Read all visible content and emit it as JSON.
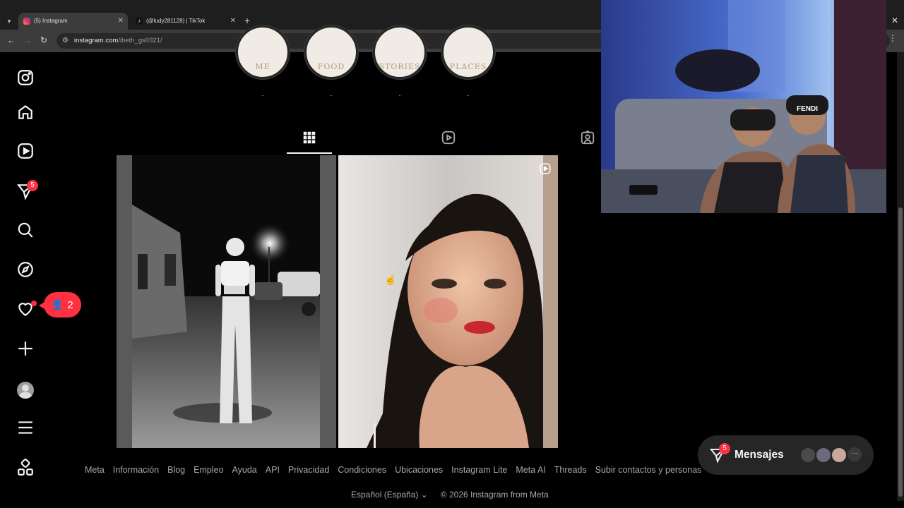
{
  "browser": {
    "tabs": [
      {
        "title": "(5) Instagram",
        "active": true
      },
      {
        "title": "(@ludy281128) | TikTok",
        "active": false
      }
    ],
    "new_tab_label": "+",
    "url_host": "instagram.com",
    "url_path": "/ibeth_gs0321/"
  },
  "sidebar": {
    "items": [
      {
        "icon": "instagram-logo-icon"
      },
      {
        "icon": "home-icon"
      },
      {
        "icon": "reels-icon"
      },
      {
        "icon": "messenger-icon",
        "badge": "5"
      },
      {
        "icon": "search-icon"
      },
      {
        "icon": "explore-icon"
      },
      {
        "icon": "heart-icon"
      },
      {
        "icon": "plus-icon"
      },
      {
        "icon": "profile-avatar"
      },
      {
        "icon": "menu-icon"
      },
      {
        "icon": "apps-icon"
      }
    ],
    "notification_count": "2"
  },
  "highlights": [
    {
      "art": "ME",
      "label": "."
    },
    {
      "art": "FOOD",
      "label": "."
    },
    {
      "art": "STORIES",
      "label": "."
    },
    {
      "art": "PLACES",
      "label": "."
    }
  ],
  "profile_tabs": [
    {
      "icon": "grid-icon",
      "active": true
    },
    {
      "icon": "reels-icon",
      "active": false
    },
    {
      "icon": "tagged-icon",
      "active": false
    }
  ],
  "footer": {
    "links": [
      "Meta",
      "Información",
      "Blog",
      "Empleo",
      "Ayuda",
      "API",
      "Privacidad",
      "Condiciones",
      "Ubicaciones",
      "Instagram Lite",
      "Meta AI",
      "Threads",
      "Subir contactos y personas"
    ],
    "language": "Español (España)",
    "copyright": "© 2026 Instagram from Meta"
  },
  "messages": {
    "label": "Mensajes",
    "badge": "5",
    "more": "···"
  },
  "colors": {
    "background": "#000000",
    "badge": "#ff3040",
    "chrome_bar": "#3c3c3c"
  }
}
